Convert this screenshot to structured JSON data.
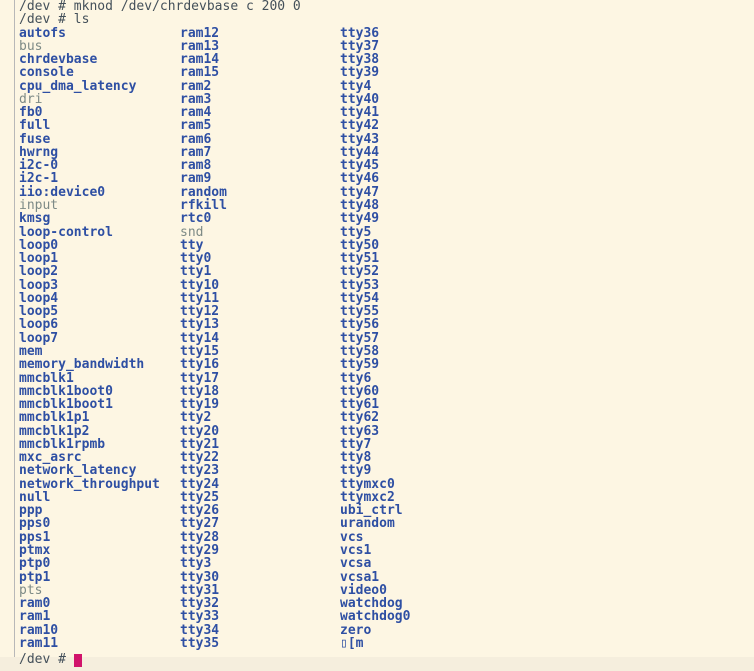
{
  "terminal": {
    "command_mknod": "/dev # mknod /dev/chrdevbase c 200 0",
    "command_ls": "/dev # ls",
    "final_prompt": "/dev # ",
    "columns": [
      [
        "autofs",
        "bus",
        "chrdevbase",
        "console",
        "cpu_dma_latency",
        "dri",
        "fb0",
        "full",
        "fuse",
        "hwrng",
        "i2c-0",
        "i2c-1",
        "iio:device0",
        "input",
        "kmsg",
        "loop-control",
        "loop0",
        "loop1",
        "loop2",
        "loop3",
        "loop4",
        "loop5",
        "loop6",
        "loop7",
        "mem",
        "memory_bandwidth",
        "mmcblk1",
        "mmcblk1boot0",
        "mmcblk1boot1",
        "mmcblk1p1",
        "mmcblk1p2",
        "mmcblk1rpmb",
        "mxc_asrc",
        "network_latency",
        "network_throughput",
        "null",
        "ppp",
        "pps0",
        "pps1",
        "ptmx",
        "ptp0",
        "ptp1",
        "pts",
        "ram0",
        "ram1",
        "ram10",
        "ram11"
      ],
      [
        "ram12",
        "ram13",
        "ram14",
        "ram15",
        "ram2",
        "ram3",
        "ram4",
        "ram5",
        "ram6",
        "ram7",
        "ram8",
        "ram9",
        "random",
        "rfkill",
        "rtc0",
        "snd",
        "tty",
        "tty0",
        "tty1",
        "tty10",
        "tty11",
        "tty12",
        "tty13",
        "tty14",
        "tty15",
        "tty16",
        "tty17",
        "tty18",
        "tty19",
        "tty2",
        "tty20",
        "tty21",
        "tty22",
        "tty23",
        "tty24",
        "tty25",
        "tty26",
        "tty27",
        "tty28",
        "tty29",
        "tty3",
        "tty30",
        "tty31",
        "tty32",
        "tty33",
        "tty34",
        "tty35"
      ],
      [
        "tty36",
        "tty37",
        "tty38",
        "tty39",
        "tty4",
        "tty40",
        "tty41",
        "tty42",
        "tty43",
        "tty44",
        "tty45",
        "tty46",
        "tty47",
        "tty48",
        "tty49",
        "tty5",
        "tty50",
        "tty51",
        "tty52",
        "tty53",
        "tty54",
        "tty55",
        "tty56",
        "tty57",
        "tty58",
        "tty59",
        "tty6",
        "tty60",
        "tty61",
        "tty62",
        "tty63",
        "tty7",
        "tty8",
        "tty9",
        "ttymxc0",
        "ttymxc2",
        "ubi_ctrl",
        "urandom",
        "vcs",
        "vcs1",
        "vcsa",
        "vcsa1",
        "video0",
        "watchdog",
        "watchdog0",
        "zero",
        "▯[m"
      ]
    ],
    "directories": [
      "bus",
      "dri",
      "input",
      "pts",
      "snd"
    ],
    "colors": {
      "background": "#fdf6e3",
      "prompt_text": "#44505a",
      "device_entry": "#2e4fa3",
      "directory_entry": "#7d8a86",
      "cursor": "#d1136b"
    }
  }
}
